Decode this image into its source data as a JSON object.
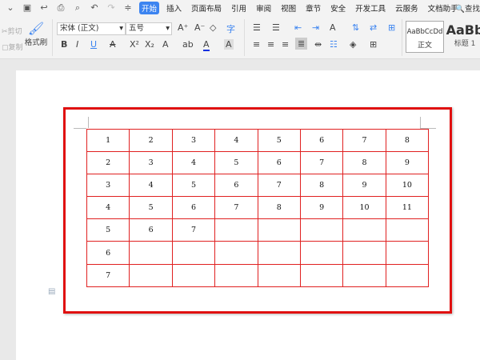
{
  "menu": {
    "tabs": [
      "开始",
      "插入",
      "页面布局",
      "引用",
      "审阅",
      "视图",
      "章节",
      "安全",
      "开发工具",
      "云服务",
      "文档助手"
    ],
    "active": "开始",
    "search": "查找"
  },
  "ribbon": {
    "cut": "剪切",
    "copy": "复制",
    "format_painter": "格式刷",
    "font": "宋体 (正文)",
    "size": "五号",
    "styles": [
      {
        "preview": "AaBbCcDd",
        "label": "正文"
      },
      {
        "preview": "AaBb",
        "label": "标题 1"
      }
    ]
  },
  "table": {
    "rows": [
      [
        "1",
        "2",
        "3",
        "4",
        "5",
        "6",
        "7",
        "8"
      ],
      [
        "2",
        "3",
        "4",
        "5",
        "6",
        "7",
        "8",
        "9"
      ],
      [
        "3",
        "4",
        "5",
        "6",
        "7",
        "8",
        "9",
        "10"
      ],
      [
        "4",
        "5",
        "6",
        "7",
        "8",
        "9",
        "10",
        "11"
      ],
      [
        "5",
        "6",
        "7",
        "",
        "",
        "",
        "",
        ""
      ],
      [
        "6",
        "",
        "",
        "",
        "",
        "",
        "",
        ""
      ],
      [
        "7",
        "",
        "",
        "",
        "",
        "",
        "",
        ""
      ]
    ]
  },
  "colors": {
    "accent": "#3c84f0",
    "selection": "#e01010",
    "grid": "#e02020"
  }
}
